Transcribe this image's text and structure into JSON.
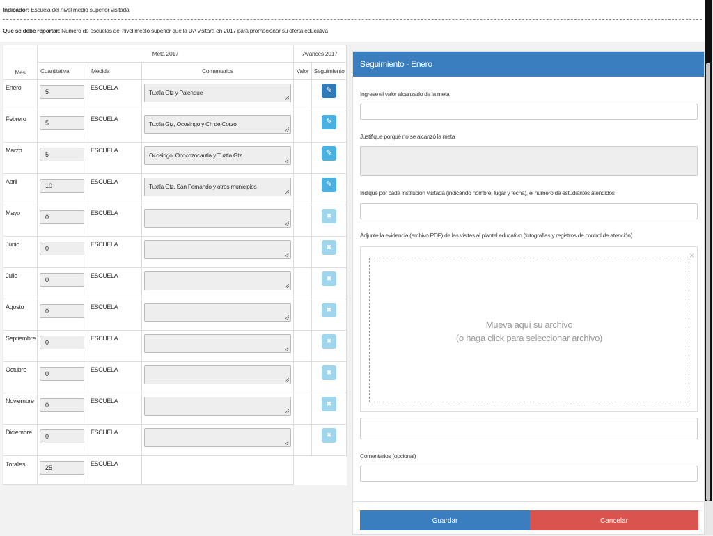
{
  "info": {
    "indicador_label": "Indicador:",
    "indicador_value": "Escuela del nivel medio superior visitada",
    "reportar_label": "Que se debe reportar:",
    "reportar_value": "Número de escuelas del nivel medio superior que la UA visitará en 2017 para promocionar su oferta educativa"
  },
  "table": {
    "group_meta": "Meta 2017",
    "group_avances": "Avances 2017",
    "headers": {
      "mes": "Mes",
      "cuantitativa": "Cuantitativa",
      "medida": "Medida",
      "comentarios": "Comentarios",
      "valor": "Valor",
      "seguimiento": "Seguimiento"
    },
    "rows": [
      {
        "mes": "Enero",
        "cuantitativa": "5",
        "medida": "ESCUELA",
        "comentarios": "Tuxtla Gtz y Palenque"
      },
      {
        "mes": "Febrero",
        "cuantitativa": "5",
        "medida": "ESCUELA",
        "comentarios": "Tuxtla Gtz, Ocosingo y Ch de Corzo"
      },
      {
        "mes": "Marzo",
        "cuantitativa": "5",
        "medida": "ESCUELA",
        "comentarios": "Ocosingo, Ococozocautla y Tuztla Gtz"
      },
      {
        "mes": "Abril",
        "cuantitativa": "10",
        "medida": "ESCUELA",
        "comentarios": "Tuxtla Gtz, San Fernando y otros municipios"
      },
      {
        "mes": "Mayo",
        "cuantitativa": "0",
        "medida": "ESCUELA",
        "comentarios": ""
      },
      {
        "mes": "Junio",
        "cuantitativa": "0",
        "medida": "ESCUELA",
        "comentarios": ""
      },
      {
        "mes": "Julio",
        "cuantitativa": "0",
        "medida": "ESCUELA",
        "comentarios": ""
      },
      {
        "mes": "Agosto",
        "cuantitativa": "0",
        "medida": "ESCUELA",
        "comentarios": ""
      },
      {
        "mes": "Septiembre",
        "cuantitativa": "0",
        "medida": "ESCUELA",
        "comentarios": ""
      },
      {
        "mes": "Octubre",
        "cuantitativa": "0",
        "medida": "ESCUELA",
        "comentarios": ""
      },
      {
        "mes": "Noviembre",
        "cuantitativa": "0",
        "medida": "ESCUELA",
        "comentarios": ""
      },
      {
        "mes": "Diciembre",
        "cuantitativa": "0",
        "medida": "ESCUELA",
        "comentarios": ""
      }
    ],
    "totales": {
      "label": "Totales",
      "cuantitativa": "25",
      "medida": "ESCUELA"
    }
  },
  "panel": {
    "title": "Seguimiento - Enero",
    "valor_label": "Ingrese el valor alcanzado de la meta",
    "justifique_label": "Justifique porqué no se alcanzó la meta",
    "institucion_label": "Indique por cada institución visitada (indicando nombre, lugar y fecha), el número de estudiantes atendidos",
    "evidencia_label": "Adjunte la evidencia (archivo PDF) de las visitas al plantel educativo (fotografías y registros de control de atención)",
    "dropzone_line1": "Mueva aquí su archivo",
    "dropzone_line2": "(o haga click para seleccionar archivo)",
    "dropzone_close": "×",
    "comentarios_label": "Comentarios (opcional)",
    "save_label": "Guardar",
    "cancel_label": "Cancelar"
  },
  "icons": {
    "edit": "pencil-icon",
    "disabled": "close-icon"
  },
  "colors": {
    "primary": "#3a7ebf",
    "edit_button": "#4ab1e0",
    "edit_button_disabled": "#9fd6ee",
    "danger": "#d9534f"
  }
}
